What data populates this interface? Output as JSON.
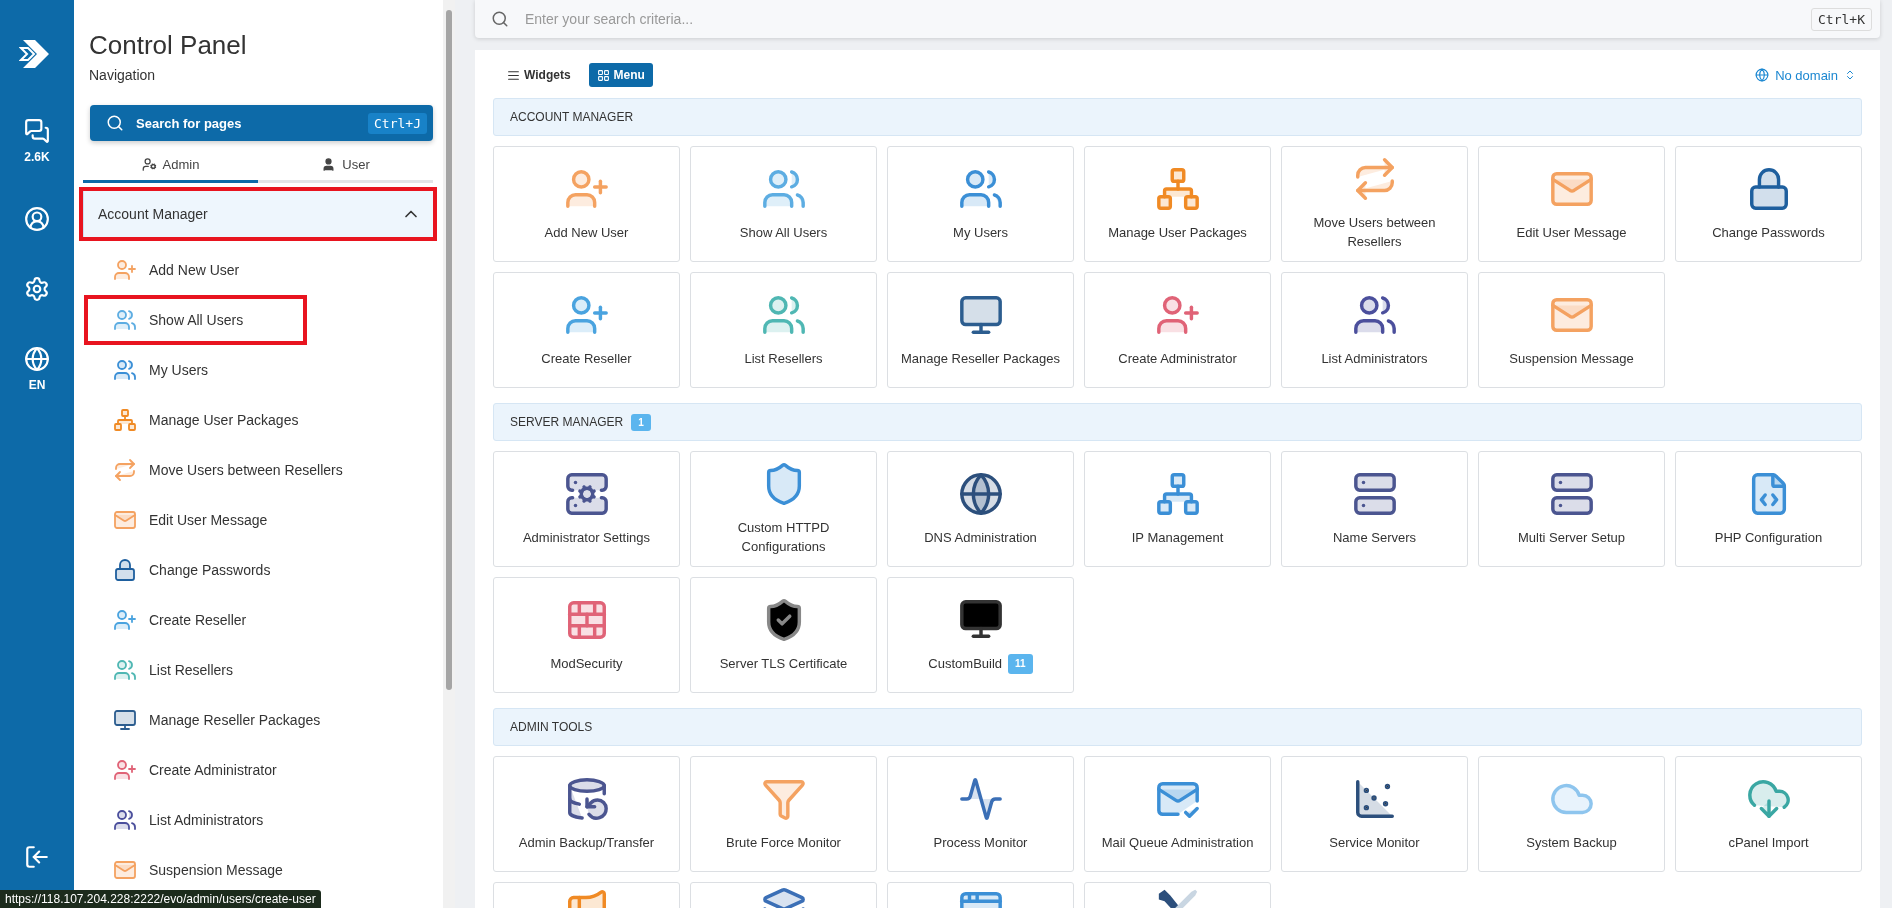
{
  "rail": {
    "chat_count": "2.6K",
    "language": "EN"
  },
  "sidebar": {
    "title": "Control Panel",
    "subtitle": "Navigation",
    "search": {
      "placeholder": "Search for pages",
      "shortcut": "Ctrl+J"
    },
    "tabs": [
      {
        "label": "Admin",
        "selected": true
      },
      {
        "label": "User",
        "selected": false
      }
    ],
    "group": {
      "label": "Account Manager",
      "expanded": true,
      "highlighted": true
    },
    "items": [
      {
        "label": "Add New User",
        "highlighted": false
      },
      {
        "label": "Show All Users",
        "highlighted": true
      },
      {
        "label": "My Users",
        "highlighted": false
      },
      {
        "label": "Manage User Packages",
        "highlighted": false
      },
      {
        "label": "Move Users between Resellers",
        "highlighted": false
      },
      {
        "label": "Edit User Message",
        "highlighted": false
      },
      {
        "label": "Change Passwords",
        "highlighted": false
      },
      {
        "label": "Create Reseller",
        "highlighted": false
      },
      {
        "label": "List Resellers",
        "highlighted": false
      },
      {
        "label": "Manage Reseller Packages",
        "highlighted": false
      },
      {
        "label": "Create Administrator",
        "highlighted": false
      },
      {
        "label": "List Administrators",
        "highlighted": false
      },
      {
        "label": "Suspension Message",
        "highlighted": false
      }
    ]
  },
  "search": {
    "placeholder": "Enter your search criteria...",
    "shortcut": "Ctrl+K"
  },
  "view_toggle": [
    {
      "label": "Widgets",
      "selected": false
    },
    {
      "label": "Menu",
      "selected": true
    }
  ],
  "domain": "No domain",
  "sections": [
    {
      "title": "ACCOUNT MANAGER",
      "tiles": [
        {
          "kind": "tile",
          "label": "Add New User"
        },
        {
          "kind": "tile",
          "label": "Show All Users"
        },
        {
          "kind": "tile",
          "label": "My Users"
        },
        {
          "kind": "tile",
          "label": "Manage User Packages"
        },
        {
          "kind": "tile",
          "label": "Move Users between Resellers"
        },
        {
          "kind": "tile",
          "label": "Edit User Message"
        },
        {
          "kind": "tile",
          "label": "Change Passwords"
        },
        {
          "kind": "tile",
          "label": "Create Reseller"
        },
        {
          "kind": "tile",
          "label": "List Resellers"
        },
        {
          "kind": "tile",
          "label": "Manage Reseller Packages"
        },
        {
          "kind": "tile",
          "label": "Create Administrator"
        },
        {
          "kind": "tile",
          "label": "List Administrators"
        },
        {
          "kind": "tile",
          "label": "Suspension Message"
        }
      ]
    },
    {
      "title": "SERVER MANAGER",
      "badge": "1",
      "tiles": [
        {
          "kind": "tile",
          "label": "Administrator Settings"
        },
        {
          "kind": "tile",
          "label": "Custom HTTPD Configurations"
        },
        {
          "kind": "tile",
          "label": "DNS Administration"
        },
        {
          "kind": "tile",
          "label": "IP Management"
        },
        {
          "kind": "tile",
          "label": "Name Servers"
        },
        {
          "kind": "tile",
          "label": "Multi Server Setup"
        },
        {
          "kind": "tile",
          "label": "PHP Configuration"
        },
        {
          "kind": "tile",
          "label": "ModSecurity"
        },
        {
          "kind": "tile",
          "label": "Server TLS Certificate"
        },
        {
          "kind": "tile",
          "label": "CustomBuild",
          "badge": "11"
        }
      ]
    },
    {
      "title": "ADMIN TOOLS",
      "tiles": [
        {
          "kind": "tile",
          "label": "Admin Backup/Transfer"
        },
        {
          "kind": "tile",
          "label": "Brute Force Monitor"
        },
        {
          "kind": "tile",
          "label": "Process Monitor"
        },
        {
          "kind": "tile",
          "label": "Mail Queue Administration"
        },
        {
          "kind": "tile",
          "label": "Service Monitor"
        },
        {
          "kind": "tile",
          "label": "System Backup"
        },
        {
          "kind": "tile",
          "label": "cPanel Import"
        },
        {
          "kind": "partial"
        },
        {
          "kind": "partial"
        },
        {
          "kind": "partial"
        },
        {
          "kind": "partial"
        }
      ]
    }
  ],
  "status_url": "https://118.107.204.228:2222/evo/admin/users/create-user"
}
